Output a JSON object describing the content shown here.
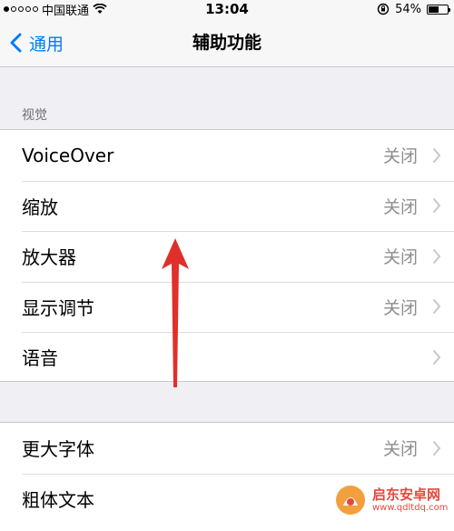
{
  "status_bar": {
    "carrier": "中国联通",
    "time": "13:04",
    "battery": "54%",
    "battery_level": 0.54
  },
  "nav": {
    "back_label": "通用",
    "title": "辅助功能"
  },
  "sections": [
    {
      "header": "视觉",
      "rows": [
        {
          "label": "VoiceOver",
          "value": "关闭"
        },
        {
          "label": "缩放",
          "value": "关闭"
        },
        {
          "label": "放大器",
          "value": "关闭"
        },
        {
          "label": "显示调节",
          "value": "关闭"
        },
        {
          "label": "语音",
          "value": ""
        }
      ]
    },
    {
      "header": "",
      "rows": [
        {
          "label": "更大字体",
          "value": "关闭"
        },
        {
          "label": "粗体文本",
          "value": ""
        }
      ]
    }
  ],
  "watermark": {
    "title": "启东安卓网",
    "url": "www.qdltdq.com"
  },
  "colors": {
    "accent": "#007aff",
    "annotation": "#e0302b",
    "secondary_text": "#8e8e93",
    "background": "#efeff4"
  }
}
